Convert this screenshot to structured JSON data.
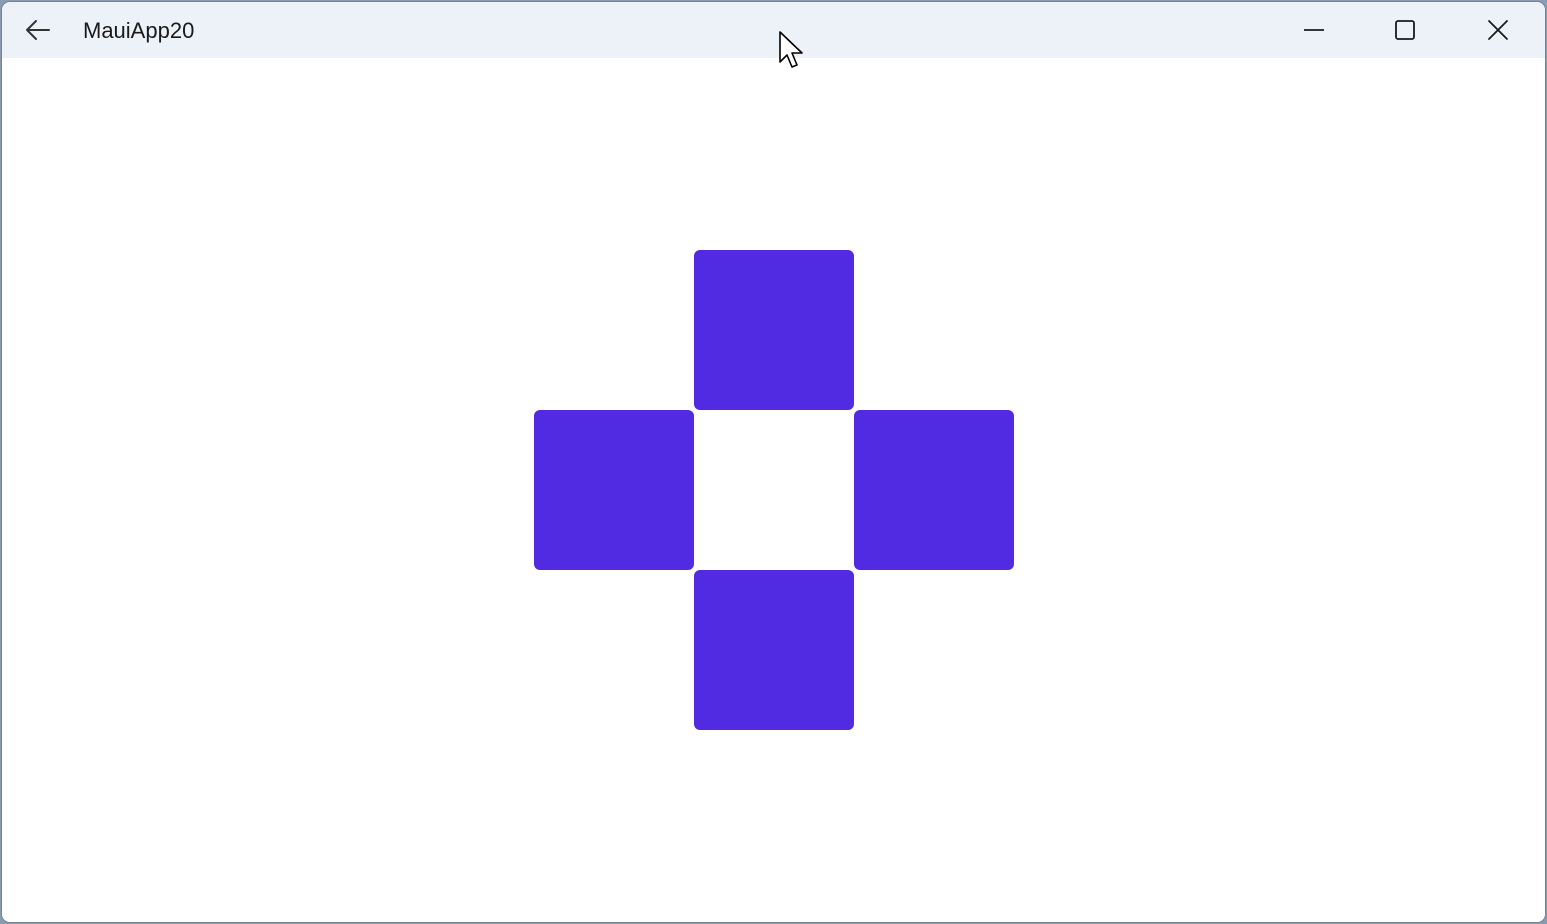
{
  "window": {
    "title": "MauiApp20"
  },
  "icons": {
    "back": "back-arrow-icon",
    "minimize": "minimize-icon",
    "maximize": "maximize-icon",
    "close": "close-icon",
    "cursor": "mouse-pointer-icon"
  },
  "colors": {
    "titlebar": "#edf2f9",
    "tile": "#512be1",
    "background": "#ffffff"
  },
  "tiles": [
    {
      "name": "top"
    },
    {
      "name": "left"
    },
    {
      "name": "right"
    },
    {
      "name": "bottom"
    }
  ]
}
